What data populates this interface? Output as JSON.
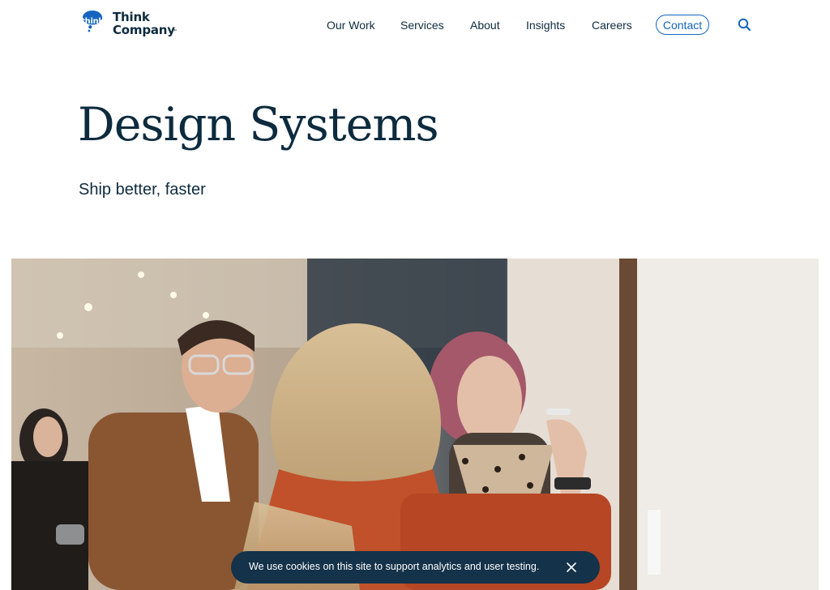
{
  "brand": {
    "bubble_text": "think",
    "name_line1": "Think",
    "name_line2": "Company",
    "trademark": "™",
    "color": "#1565c0"
  },
  "nav": {
    "items": [
      {
        "label": "Our Work"
      },
      {
        "label": "Services"
      },
      {
        "label": "About"
      },
      {
        "label": "Insights"
      },
      {
        "label": "Careers"
      }
    ],
    "contact_label": "Contact",
    "search_icon": "search-icon"
  },
  "hero": {
    "title": "Design Systems",
    "subtitle": "Ship better, faster"
  },
  "cookie_banner": {
    "message": "We use cookies on this site to support analytics and user testing.",
    "close_icon": "close-icon"
  },
  "colors": {
    "text": "#0d2b3e",
    "accent": "#1565c0",
    "banner_bg": "#14324a"
  }
}
